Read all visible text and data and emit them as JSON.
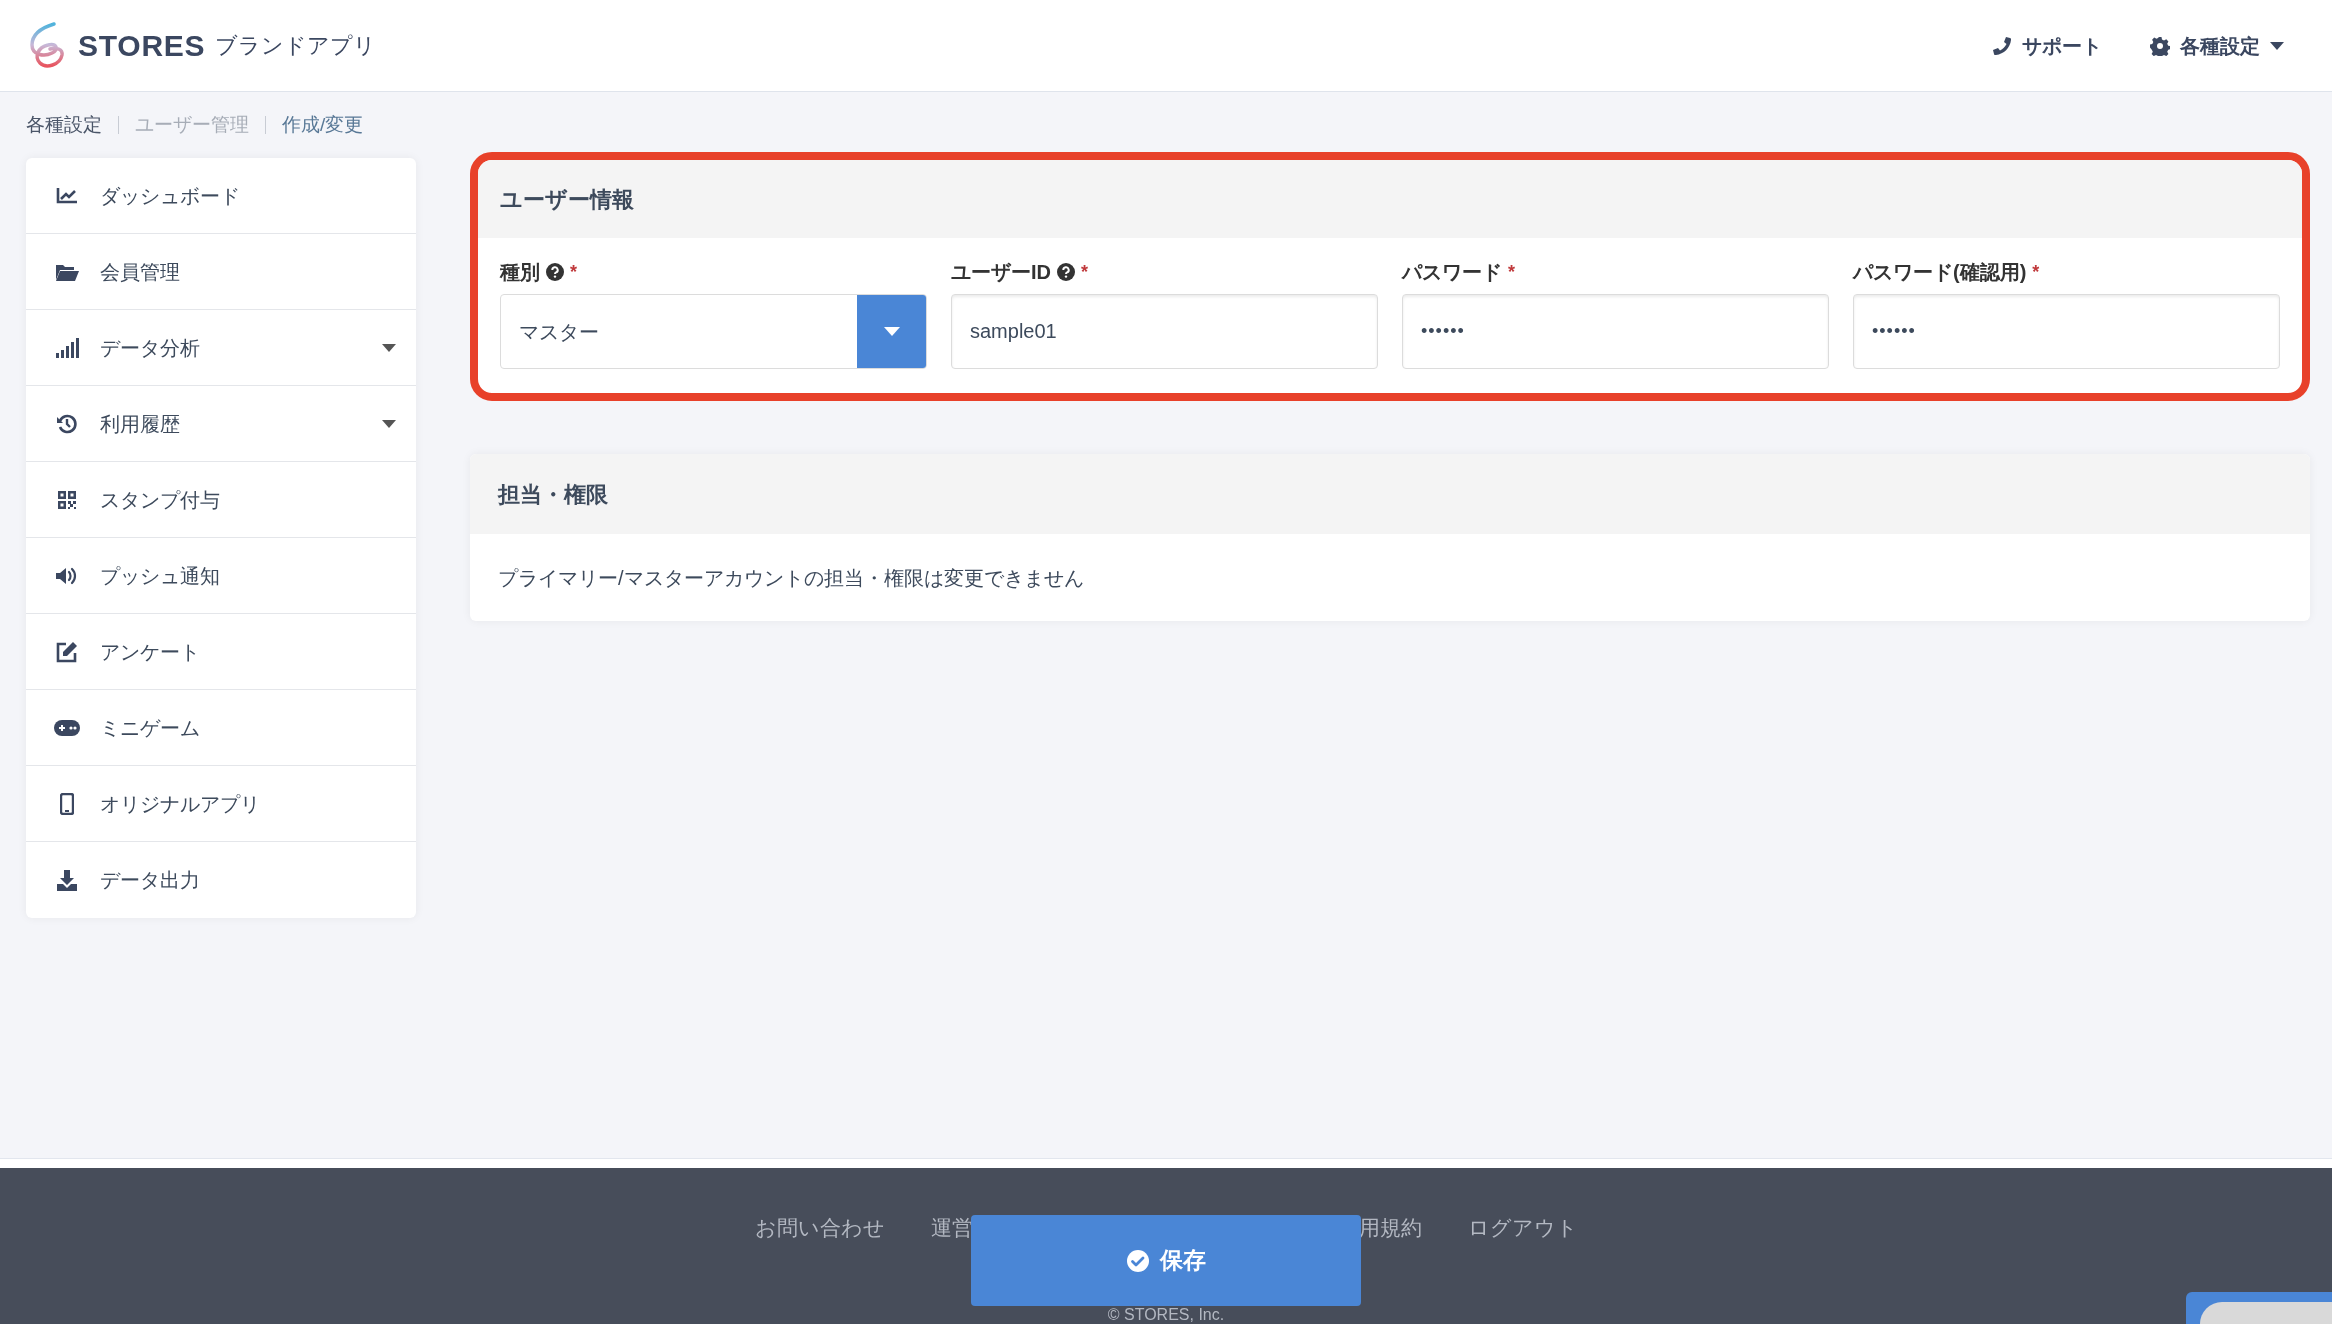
{
  "header": {
    "brand": "STORES",
    "app_name": "ブランドアプリ",
    "links": [
      {
        "label": "サポート",
        "kind": "support"
      },
      {
        "label": "各種設定",
        "kind": "settings"
      }
    ]
  },
  "breadcrumb": [
    {
      "label": "各種設定",
      "kind": "link"
    },
    {
      "label": "ユーザー管理",
      "kind": "muted"
    },
    {
      "label": "作成/変更",
      "kind": "current"
    }
  ],
  "sidebar": {
    "items": [
      {
        "label": "ダッシュボード",
        "kind": "link"
      },
      {
        "label": "会員管理",
        "kind": "link"
      },
      {
        "label": "データ分析",
        "kind": "dropdown"
      },
      {
        "label": "利用履歴",
        "kind": "dropdown"
      },
      {
        "label": "スタンプ付与",
        "kind": "link"
      },
      {
        "label": "プッシュ通知",
        "kind": "link"
      },
      {
        "label": "アンケート",
        "kind": "link"
      },
      {
        "label": "ミニゲーム",
        "kind": "link"
      },
      {
        "label": "オリジナルアプリ",
        "kind": "link"
      },
      {
        "label": "データ出力",
        "kind": "link"
      }
    ]
  },
  "user_info": {
    "title": "ユーザー情報",
    "fields": [
      {
        "label": "種別",
        "help": true,
        "required_mark": "*",
        "kind": "select",
        "value": "マスター"
      },
      {
        "label": "ユーザーID",
        "help": true,
        "required_mark": "*",
        "kind": "text",
        "value": "sample01"
      },
      {
        "label": "パスワード",
        "help": false,
        "required_mark": "*",
        "kind": "password",
        "value": "••••••"
      },
      {
        "label": "パスワード(確認用)",
        "help": false,
        "required_mark": "*",
        "kind": "password",
        "value": "••••••"
      }
    ]
  },
  "permissions": {
    "title": "担当・権限",
    "message": "プライマリー/マスターアカウントの担当・権限は変更できません"
  },
  "footer": {
    "links_left": [
      "お問い合わせ",
      "運営"
    ],
    "links_right": [
      "用規約",
      "ログアウト"
    ],
    "copyright": "© STORES, Inc."
  },
  "save_button": {
    "label": "保存"
  }
}
